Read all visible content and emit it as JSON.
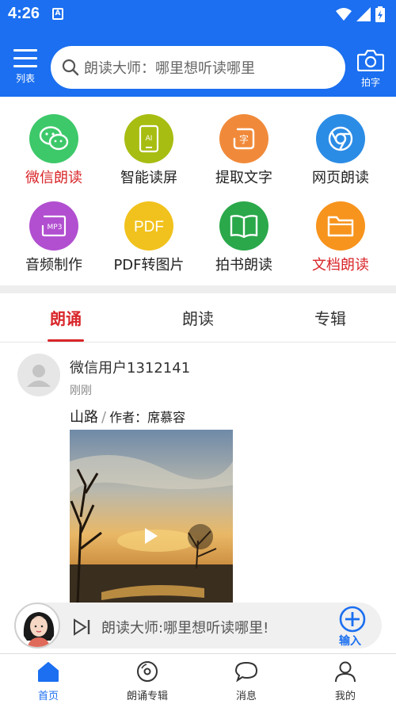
{
  "status_bar": {
    "time": "4:26",
    "a_badge": "A"
  },
  "header": {
    "menu_label": "列表",
    "search_placeholder": "朗读大师：哪里想听读哪里",
    "camera_label": "拍字"
  },
  "features": [
    {
      "label": "微信朗读",
      "icon": "wechat-icon",
      "color": "#3dc86a",
      "highlight": true
    },
    {
      "label": "智能读屏",
      "icon": "ai-screen-icon",
      "color": "#a8bd12",
      "highlight": false
    },
    {
      "label": "提取文字",
      "icon": "extract-text-icon",
      "color": "#f08a3a",
      "highlight": false
    },
    {
      "label": "网页朗读",
      "icon": "browser-icon",
      "color": "#2b8ce6",
      "highlight": false
    },
    {
      "label": "音频制作",
      "icon": "mp3-icon",
      "color": "#b14fd0",
      "highlight": false
    },
    {
      "label": "PDF转图片",
      "icon": "pdf-icon",
      "color": "#f1c21d",
      "highlight": false
    },
    {
      "label": "拍书朗读",
      "icon": "book-icon",
      "color": "#2aa84a",
      "highlight": false
    },
    {
      "label": "文档朗读",
      "icon": "folder-icon",
      "color": "#f7941d",
      "highlight": true
    }
  ],
  "feature_icon_text": {
    "ai": "AI",
    "zi": "字",
    "mp3": "MP3",
    "pdf": "PDF"
  },
  "tabs": [
    {
      "label": "朗诵",
      "active": true
    },
    {
      "label": "朗读",
      "active": false
    },
    {
      "label": "专辑",
      "active": false
    }
  ],
  "post": {
    "user": "微信用户1312141",
    "time": "刚刚",
    "title": "山路",
    "separator": "/",
    "author_prefix": "作者：",
    "author": "席慕容"
  },
  "player": {
    "text": "朗读大师:哪里想听读哪里!",
    "add_label": "输入"
  },
  "bottom_nav": [
    {
      "label": "首页",
      "icon": "home-icon",
      "active": true
    },
    {
      "label": "朗诵专辑",
      "icon": "disc-icon",
      "active": false
    },
    {
      "label": "消息",
      "icon": "message-icon",
      "active": false
    },
    {
      "label": "我的",
      "icon": "profile-icon",
      "active": false
    }
  ],
  "colors": {
    "primary": "#1b6ff0",
    "accent_red": "#d9262a"
  }
}
